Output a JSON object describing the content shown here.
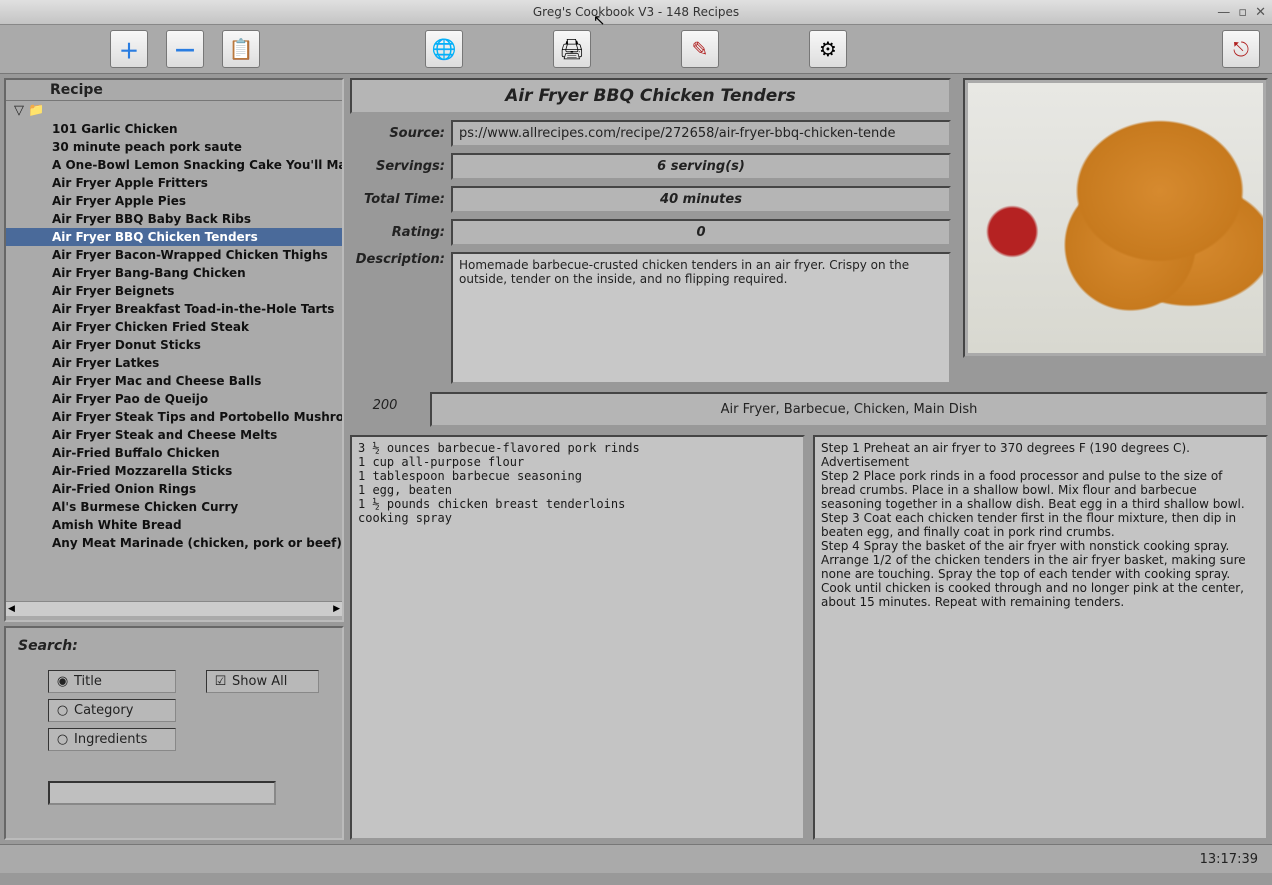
{
  "window": {
    "title": "Greg's Cookbook V3 - 148 Recipes",
    "min": "—",
    "max": "▫",
    "close": "✕"
  },
  "toolbar": {
    "add": "＋",
    "remove": "—",
    "paste": "📋",
    "web": "🌐",
    "print": "🖨",
    "edit": "✎",
    "settings": "⚙",
    "exit": "⎋"
  },
  "tree": {
    "header": "Recipe",
    "folder_icon": "▽ 📁",
    "items": [
      "101 Garlic Chicken",
      "30 minute peach pork saute",
      "A One-Bowl Lemon Snacking Cake You'll Make Y",
      "Air Fryer Apple Fritters",
      "Air Fryer Apple Pies",
      "Air Fryer BBQ Baby Back Ribs",
      "Air Fryer BBQ Chicken Tenders",
      "Air Fryer Bacon-Wrapped Chicken Thighs",
      "Air Fryer Bang-Bang Chicken",
      "Air Fryer Beignets",
      "Air Fryer Breakfast Toad-in-the-Hole Tarts",
      "Air Fryer Chicken Fried Steak",
      "Air Fryer Donut Sticks",
      "Air Fryer Latkes",
      "Air Fryer Mac and Cheese Balls",
      "Air Fryer Pao de Queijo",
      "Air Fryer Steak Tips and Portobello Mushrooms",
      "Air Fryer Steak and Cheese Melts",
      "Air-Fried Buffalo Chicken",
      "Air-Fried Mozzarella Sticks",
      "Air-Fried Onion Rings",
      "Al's Burmese Chicken Curry",
      "Amish White Bread",
      "Any Meat Marinade (chicken, pork or beef)"
    ],
    "selected_index": 6
  },
  "search": {
    "label": "Search:",
    "opt_title": "Title",
    "opt_showall": "Show All",
    "opt_category": "Category",
    "opt_ingredients": "Ingredients",
    "value": ""
  },
  "recipe": {
    "title": "Air Fryer BBQ Chicken Tenders",
    "labels": {
      "source": "Source:",
      "servings": "Servings:",
      "total": "Total Time:",
      "rating": "Rating:",
      "description": "Description:"
    },
    "source": "ps://www.allrecipes.com/recipe/272658/air-fryer-bbq-chicken-tende",
    "servings": "6 serving(s)",
    "total_time": "40 minutes",
    "rating": "0",
    "description": "Homemade barbecue-crusted chicken tenders in an air fryer. Crispy on the outside, tender on the inside, and no flipping required.",
    "code": "200",
    "tags": "Air Fryer, Barbecue, Chicken, Main Dish",
    "ingredients": "3 ½ ounces barbecue-flavored pork rinds\n1 cup all-purpose flour\n1 tablespoon barbecue seasoning\n1 egg, beaten\n1 ½ pounds chicken breast tenderloins\ncooking spray",
    "instructions": "Step 1 Preheat an air fryer to 370 degrees F (190 degrees C). Advertisement\nStep 2 Place pork rinds in a food processor and pulse to the size of bread crumbs. Place in a shallow bowl. Mix flour and barbecue seasoning together in a shallow dish. Beat egg in a third shallow bowl.\nStep 3 Coat each chicken tender first in the flour mixture, then dip in beaten egg, and finally coat in pork rind crumbs.\nStep 4 Spray the basket of the air fryer with nonstick cooking spray. Arrange 1/2 of the chicken tenders in the air fryer basket, making sure none are touching. Spray the top of each tender with cooking spray. Cook until chicken is cooked through and no longer pink at the center, about 15 minutes. Repeat with remaining tenders."
  },
  "status": {
    "time": "13:17:39"
  }
}
